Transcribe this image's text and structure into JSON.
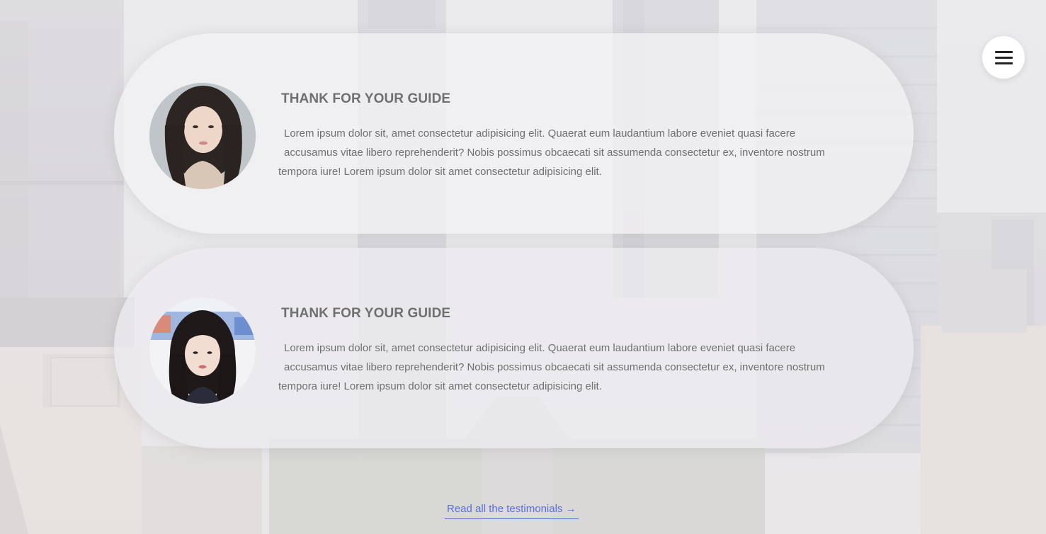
{
  "menu": {
    "icon": "hamburger-menu-icon"
  },
  "testimonials": [
    {
      "title": "THANK FOR YOUR GUIDE",
      "lines": [
        "Lorem ipsum dolor sit, amet consectetur adipisicing elit. Quaerat eum laudantium labore eveniet quasi facere",
        "accusamus vitae libero reprehenderit? Nobis possimus obcaecati sit assumenda consectetur ex, inventore nostrum",
        "tempora iure! Lorem ipsum dolor sit amet consectetur adipisicing elit."
      ]
    },
    {
      "title": "THANK FOR YOUR GUIDE",
      "lines": [
        "Lorem ipsum dolor sit, amet consectetur adipisicing elit. Quaerat eum laudantium labore eveniet quasi facere",
        "accusamus vitae libero reprehenderit? Nobis possimus obcaecati sit assumenda consectetur ex, inventore nostrum",
        "tempora iure! Lorem ipsum dolor sit amet consectetur adipisicing elit."
      ]
    }
  ],
  "footer": {
    "read_all_label": "Read all the testimonials →"
  },
  "colors": {
    "title": "#6f6f72",
    "text": "#707073",
    "link": "#5a6fd8",
    "card": "#f1f0f2"
  }
}
